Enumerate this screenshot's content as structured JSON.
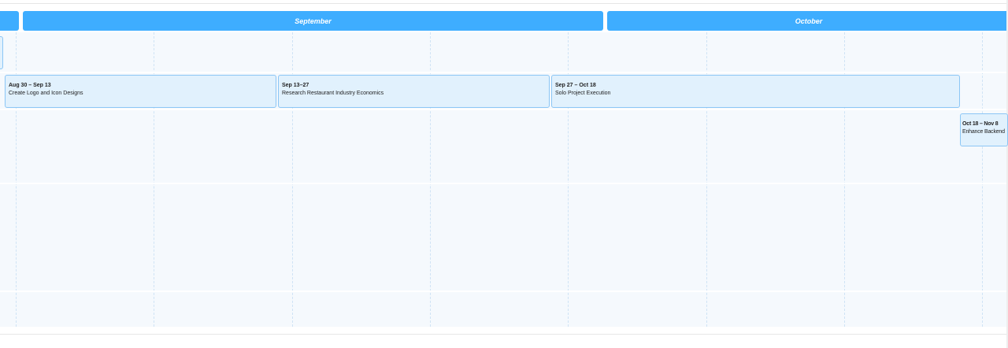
{
  "months": [
    {
      "label": ""
    },
    {
      "label": "September"
    },
    {
      "label": "October"
    }
  ],
  "events": [
    {
      "dates": "",
      "title": ""
    },
    {
      "dates": "Aug 30 – Sep 13",
      "title": "Create Logo and Icon Designs"
    },
    {
      "dates": "Sep 13–27",
      "title": "Research Restaurant Industry Economics"
    },
    {
      "dates": "Sep 27 – Oct 18",
      "title": "Solo Project Execution"
    },
    {
      "dates": "Oct 18 – Nov 8",
      "title": "Enhance Backend"
    }
  ]
}
